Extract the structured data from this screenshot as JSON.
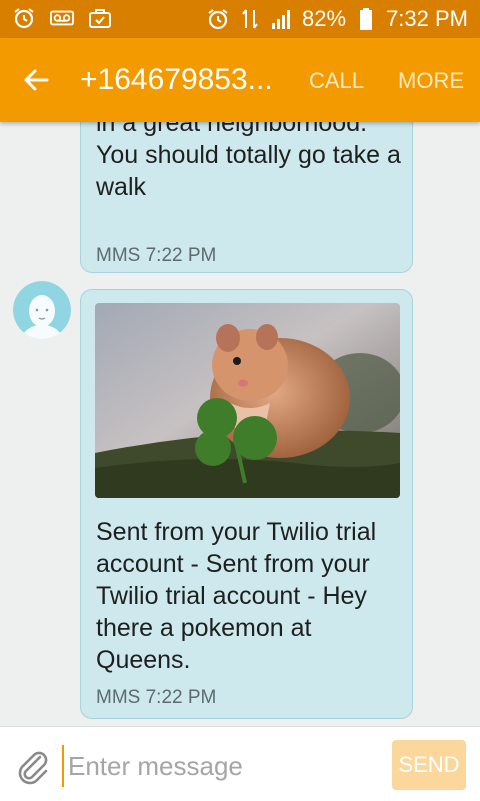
{
  "status_bar": {
    "battery": "82%",
    "time": "7:32 PM",
    "icons_left": [
      "alarm-icon",
      "voicemail-icon",
      "briefcase-icon"
    ],
    "icons_right": [
      "alarm-icon",
      "data-icon",
      "signal-icon",
      "battery-icon"
    ]
  },
  "app_bar": {
    "title": "+164679853...",
    "call_label": "CALL",
    "more_label": "MORE",
    "background": "#f29a00"
  },
  "messages": [
    {
      "text": "beautiful day, and you live in a great neighborhood. You should totally go take a walk",
      "meta": "MMS 7:22 PM"
    },
    {
      "image": "hamster-with-clover-photo",
      "text": "Sent from your Twilio trial account - Sent from your Twilio trial account - Hey there a pokemon at Queens.",
      "meta": "MMS 7:22 PM"
    }
  ],
  "composer": {
    "placeholder": "Enter message",
    "send_label": "SEND"
  },
  "colors": {
    "status_bar": "#d97f00",
    "bubble": "#cde9ee",
    "send_button": "#fbd79c"
  }
}
